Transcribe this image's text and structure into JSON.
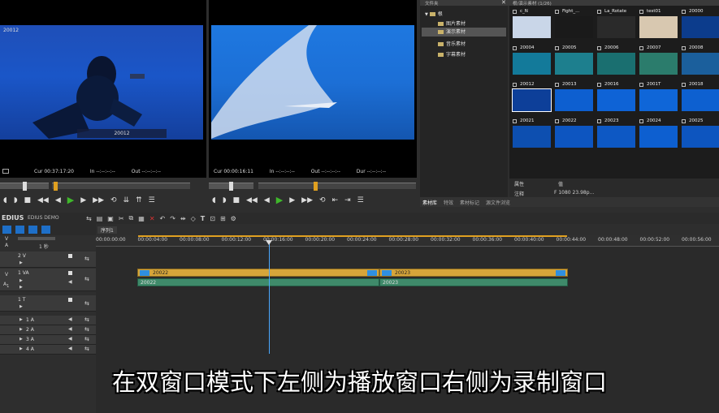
{
  "player": {
    "clip_label": "20012",
    "corner_label": "20012",
    "cur": "Cur 00:37:17:20",
    "in": "In --:--:--:--",
    "out": "Out --:--:--:--"
  },
  "recorder": {
    "cur": "Cur 00:00:16:11",
    "in": "In --:--:--:--",
    "out": "Out --:--:--:--",
    "dur": "Dur --:--:--:--"
  },
  "bin": {
    "header_left": "文件夹",
    "header_right": "根/演示素材 (1/26)",
    "tree": [
      {
        "label": "根"
      },
      {
        "label": "图片素材"
      },
      {
        "label": "演示素材"
      },
      {
        "label": "音乐素材"
      },
      {
        "label": "字幕素材"
      }
    ],
    "thumbs": [
      {
        "label": "c_N"
      },
      {
        "label": "Fight_..."
      },
      {
        "label": "La_Rotate"
      },
      {
        "label": "test01"
      },
      {
        "label": "20000"
      },
      {
        "label": "20004"
      },
      {
        "label": "20005"
      },
      {
        "label": "20006"
      },
      {
        "label": "20007"
      },
      {
        "label": "20008"
      },
      {
        "label": "20012"
      },
      {
        "label": "20013"
      },
      {
        "label": "20016"
      },
      {
        "label": "2001T"
      },
      {
        "label": "20018"
      },
      {
        "label": "20021"
      },
      {
        "label": "20022"
      },
      {
        "label": "20023"
      },
      {
        "label": "20024"
      },
      {
        "label": "20025"
      }
    ],
    "props": {
      "col1": "属性",
      "col2": "值",
      "row_key": "注释",
      "row_val": "F 1080 23.98p..."
    },
    "tabs": [
      "素材库",
      "特效",
      "素材标记",
      "源文件浏览"
    ]
  },
  "app": {
    "logo": "EDIUS",
    "project": "EDIUS DEMO"
  },
  "timeline": {
    "sequence_tab": "序列1",
    "zoom": "1 秒",
    "ruler": [
      "00:00:00:00",
      "00:00:04:00",
      "00:00:08:00",
      "00:00:12:00",
      "00:00:16:00",
      "00:00:20:00",
      "00:00:24:00",
      "00:00:28:00",
      "00:00:32:00",
      "00:00:36:00",
      "00:00:40:00",
      "00:00:44:00",
      "00:00:48:00",
      "00:00:52:00",
      "00:00:56:00"
    ],
    "tracks": [
      {
        "label": "2 V"
      },
      {
        "label": "1 VA"
      },
      {
        "label": "1 T"
      },
      {
        "label": "1 A"
      },
      {
        "label": "2 A"
      },
      {
        "label": "3 A"
      },
      {
        "label": "4 A"
      }
    ],
    "clips": [
      {
        "label": "20022"
      },
      {
        "label": "20023"
      },
      {
        "label": "20022"
      },
      {
        "label": "20023"
      }
    ]
  },
  "subtitle": "在双窗口模式下左侧为播放窗口右侧为录制窗口",
  "colors": {
    "video_clip": "#d6a53a",
    "audio_clip": "#3f8a6a",
    "accent_blue": "#2f8fe0"
  }
}
